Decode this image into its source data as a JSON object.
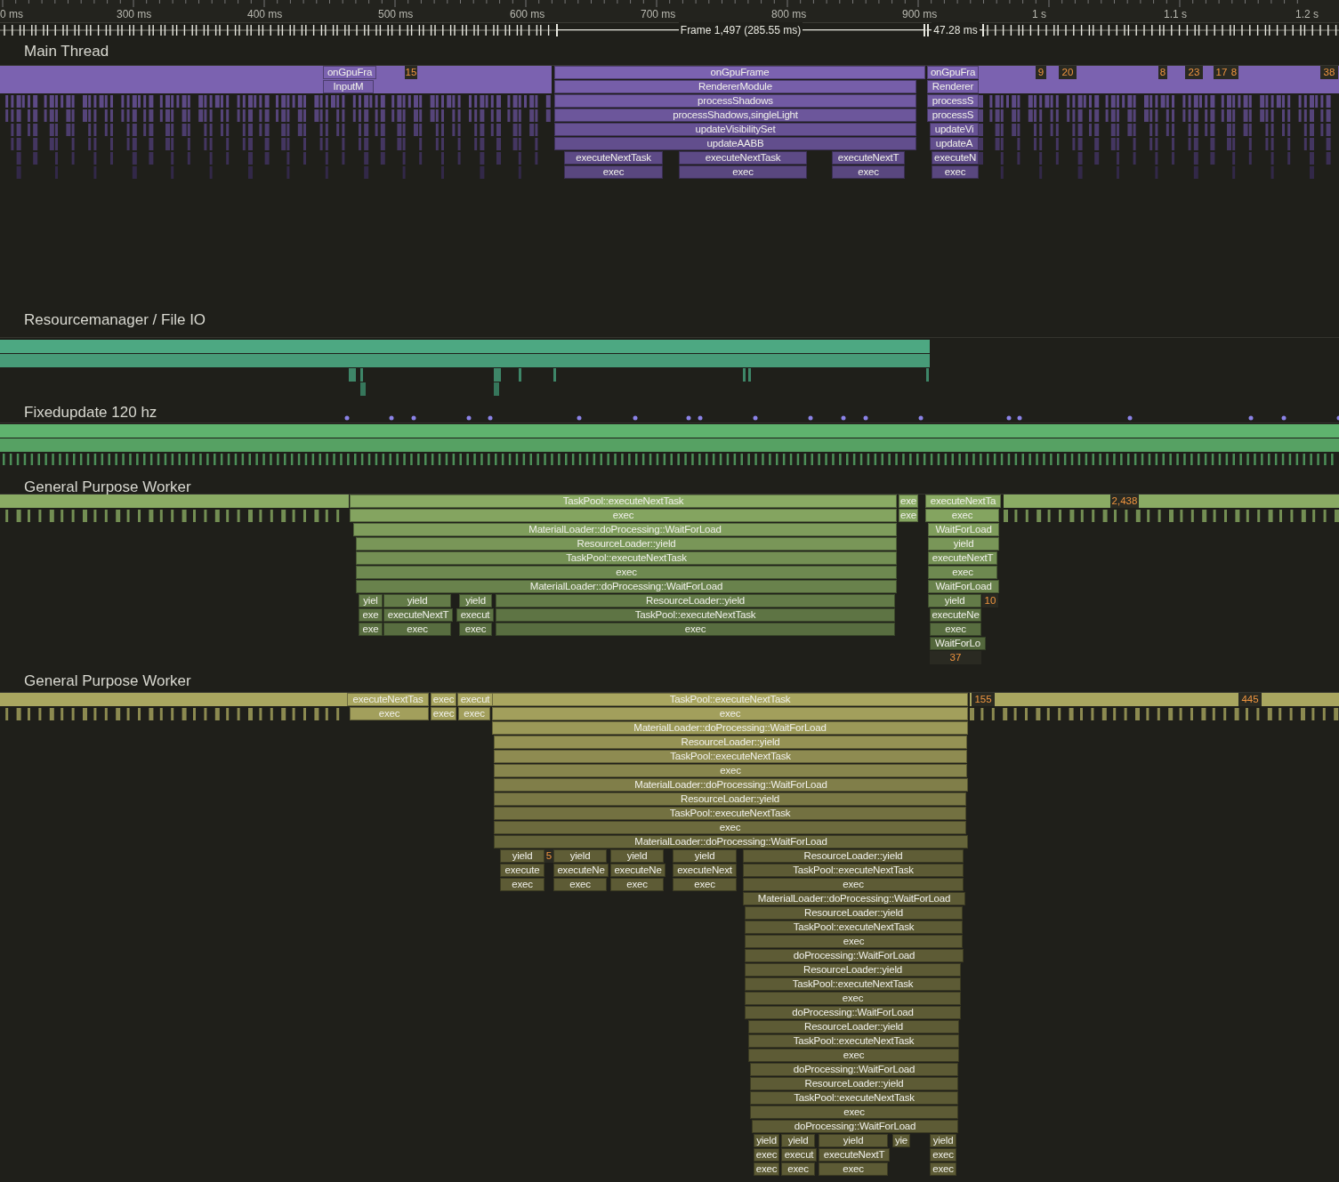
{
  "ruler": {
    "ticks": [
      "0 ms",
      "300 ms",
      "400 ms",
      "500 ms",
      "600 ms",
      "700 ms",
      "800 ms",
      "900 ms",
      "1 s",
      "1.1 s",
      "1.2 s"
    ]
  },
  "frames": [
    {
      "label": "Frame 1,497 (285.55 ms)"
    },
    {
      "label": "47.28 ms"
    }
  ],
  "tracks": [
    {
      "name": "Main Thread",
      "color": "#7b62b0",
      "zones": [
        {
          "kind": "zone",
          "label": "onGpuFra"
        },
        {
          "kind": "count",
          "label": "15"
        },
        {
          "kind": "zone",
          "label": "onGpuFrame"
        },
        {
          "kind": "zone",
          "label": "onGpuFra"
        },
        {
          "kind": "count",
          "label": "9"
        },
        {
          "kind": "count",
          "label": "20"
        },
        {
          "kind": "count",
          "label": "8"
        },
        {
          "kind": "count",
          "label": "23"
        },
        {
          "kind": "count",
          "label": "17"
        },
        {
          "kind": "count",
          "label": "8"
        },
        {
          "kind": "count",
          "label": "38"
        },
        {
          "kind": "zone",
          "label": "InputM"
        },
        {
          "kind": "zone",
          "label": "RendererModule"
        },
        {
          "kind": "zone",
          "label": "Renderer"
        },
        {
          "kind": "zone",
          "label": "processShadows"
        },
        {
          "kind": "zone",
          "label": "processS"
        },
        {
          "kind": "zone",
          "label": "processShadows,singleLight"
        },
        {
          "kind": "zone",
          "label": "processS"
        },
        {
          "kind": "zone",
          "label": "updateVisibilitySet"
        },
        {
          "kind": "zone",
          "label": "updateVi"
        },
        {
          "kind": "zone",
          "label": "updateAABB"
        },
        {
          "kind": "zone",
          "label": "updateA"
        },
        {
          "kind": "zone",
          "label": "executeNextTask"
        },
        {
          "kind": "zone",
          "label": "executeNextTask"
        },
        {
          "kind": "zone",
          "label": "executeNextT"
        },
        {
          "kind": "zone",
          "label": "executeN"
        },
        {
          "kind": "zone",
          "label": "exec"
        },
        {
          "kind": "zone",
          "label": "exec"
        },
        {
          "kind": "zone",
          "label": "exec"
        },
        {
          "kind": "zone",
          "label": "exec"
        }
      ]
    },
    {
      "name": "Resourcemanager / File IO",
      "color": "#4da882"
    },
    {
      "name": "Fixedupdate 120 hz",
      "color": "#5fb36e"
    },
    {
      "name": "General Purpose Worker",
      "color": "#8aab64",
      "zones": [
        {
          "kind": "zone",
          "label": "TaskPool::executeNextTask"
        },
        {
          "kind": "zone",
          "label": "exe"
        },
        {
          "kind": "zone",
          "label": "executeNextTa"
        },
        {
          "kind": "count",
          "label": "2,438"
        },
        {
          "kind": "zone",
          "label": "exec"
        },
        {
          "kind": "zone",
          "label": "exe"
        },
        {
          "kind": "zone",
          "label": "exec"
        },
        {
          "kind": "zone",
          "label": "MaterialLoader::doProcessing::WaitForLoad"
        },
        {
          "kind": "zone",
          "label": "WaitForLoad"
        },
        {
          "kind": "zone",
          "label": "ResourceLoader::yield"
        },
        {
          "kind": "zone",
          "label": "yield"
        },
        {
          "kind": "zone",
          "label": "TaskPool::executeNextTask"
        },
        {
          "kind": "zone",
          "label": "executeNextT"
        },
        {
          "kind": "zone",
          "label": "exec"
        },
        {
          "kind": "zone",
          "label": "exec"
        },
        {
          "kind": "zone",
          "label": "MaterialLoader::doProcessing::WaitForLoad"
        },
        {
          "kind": "zone",
          "label": "WaitForLoad"
        },
        {
          "kind": "zone",
          "label": "yiel"
        },
        {
          "kind": "zone",
          "label": "yield"
        },
        {
          "kind": "zone",
          "label": "yield"
        },
        {
          "kind": "zone",
          "label": "ResourceLoader::yield"
        },
        {
          "kind": "zone",
          "label": "yield"
        },
        {
          "kind": "count",
          "label": "10"
        },
        {
          "kind": "zone",
          "label": "exe"
        },
        {
          "kind": "zone",
          "label": "executeNextT"
        },
        {
          "kind": "zone",
          "label": "execut"
        },
        {
          "kind": "zone",
          "label": "TaskPool::executeNextTask"
        },
        {
          "kind": "zone",
          "label": "executeNe"
        },
        {
          "kind": "zone",
          "label": "exe"
        },
        {
          "kind": "zone",
          "label": "exec"
        },
        {
          "kind": "zone",
          "label": "exec"
        },
        {
          "kind": "zone",
          "label": "exec"
        },
        {
          "kind": "zone",
          "label": "exec"
        },
        {
          "kind": "zone",
          "label": "WaitForLo"
        },
        {
          "kind": "count",
          "label": "37"
        }
      ]
    },
    {
      "name": "General Purpose Worker",
      "color": "#a9a660",
      "zones": [
        {
          "kind": "zone",
          "label": "executeNextTas"
        },
        {
          "kind": "zone",
          "label": "exec"
        },
        {
          "kind": "zone",
          "label": "execut"
        },
        {
          "kind": "zone",
          "label": "TaskPool::executeNextTask"
        },
        {
          "kind": "count",
          "label": "155"
        },
        {
          "kind": "count",
          "label": "445"
        },
        {
          "kind": "zone",
          "label": "exec"
        },
        {
          "kind": "zone",
          "label": "exec"
        },
        {
          "kind": "zone",
          "label": "exec"
        },
        {
          "kind": "zone",
          "label": "exec"
        },
        {
          "kind": "zone",
          "label": "MaterialLoader::doProcessing::WaitForLoad"
        },
        {
          "kind": "zone",
          "label": "ResourceLoader::yield"
        },
        {
          "kind": "zone",
          "label": "TaskPool::executeNextTask"
        },
        {
          "kind": "zone",
          "label": "exec"
        },
        {
          "kind": "zone",
          "label": "MaterialLoader::doProcessing::WaitForLoad"
        },
        {
          "kind": "zone",
          "label": "ResourceLoader::yield"
        },
        {
          "kind": "zone",
          "label": "TaskPool::executeNextTask"
        },
        {
          "kind": "zone",
          "label": "exec"
        },
        {
          "kind": "zone",
          "label": "MaterialLoader::doProcessing::WaitForLoad"
        },
        {
          "kind": "zone",
          "label": "yield"
        },
        {
          "kind": "count",
          "label": "5"
        },
        {
          "kind": "zone",
          "label": "yield"
        },
        {
          "kind": "zone",
          "label": "yield"
        },
        {
          "kind": "zone",
          "label": "yield"
        },
        {
          "kind": "zone",
          "label": "ResourceLoader::yield"
        },
        {
          "kind": "zone",
          "label": "execute"
        },
        {
          "kind": "zone",
          "label": "executeNe"
        },
        {
          "kind": "zone",
          "label": "executeNe"
        },
        {
          "kind": "zone",
          "label": "executeNext"
        },
        {
          "kind": "zone",
          "label": "TaskPool::executeNextTask"
        },
        {
          "kind": "zone",
          "label": "exec"
        },
        {
          "kind": "zone",
          "label": "exec"
        },
        {
          "kind": "zone",
          "label": "exec"
        },
        {
          "kind": "zone",
          "label": "exec"
        },
        {
          "kind": "zone",
          "label": "exec"
        },
        {
          "kind": "zone",
          "label": "MaterialLoader::doProcessing::WaitForLoad"
        },
        {
          "kind": "zone",
          "label": "ResourceLoader::yield"
        },
        {
          "kind": "zone",
          "label": "TaskPool::executeNextTask"
        },
        {
          "kind": "zone",
          "label": "exec"
        },
        {
          "kind": "zone",
          "label": "doProcessing::WaitForLoad"
        },
        {
          "kind": "zone",
          "label": "ResourceLoader::yield"
        },
        {
          "kind": "zone",
          "label": "TaskPool::executeNextTask"
        },
        {
          "kind": "zone",
          "label": "exec"
        },
        {
          "kind": "zone",
          "label": "doProcessing::WaitForLoad"
        },
        {
          "kind": "zone",
          "label": "ResourceLoader::yield"
        },
        {
          "kind": "zone",
          "label": "TaskPool::executeNextTask"
        },
        {
          "kind": "zone",
          "label": "exec"
        },
        {
          "kind": "zone",
          "label": "doProcessing::WaitForLoad"
        },
        {
          "kind": "zone",
          "label": "ResourceLoader::yield"
        },
        {
          "kind": "zone",
          "label": "TaskPool::executeNextTask"
        },
        {
          "kind": "zone",
          "label": "exec"
        },
        {
          "kind": "zone",
          "label": "doProcessing::WaitForLoad"
        },
        {
          "kind": "zone",
          "label": "yield"
        },
        {
          "kind": "zone",
          "label": "yield"
        },
        {
          "kind": "zone",
          "label": "yield"
        },
        {
          "kind": "zone",
          "label": "yie"
        },
        {
          "kind": "zone",
          "label": "yield"
        },
        {
          "kind": "zone",
          "label": "exec"
        },
        {
          "kind": "zone",
          "label": "execut"
        },
        {
          "kind": "zone",
          "label": "executeNextT"
        },
        {
          "kind": "zone",
          "label": "exec"
        },
        {
          "kind": "zone",
          "label": "exec"
        },
        {
          "kind": "zone",
          "label": "exec"
        },
        {
          "kind": "zone",
          "label": "exec"
        },
        {
          "kind": "zone",
          "label": "exec"
        }
      ]
    }
  ]
}
